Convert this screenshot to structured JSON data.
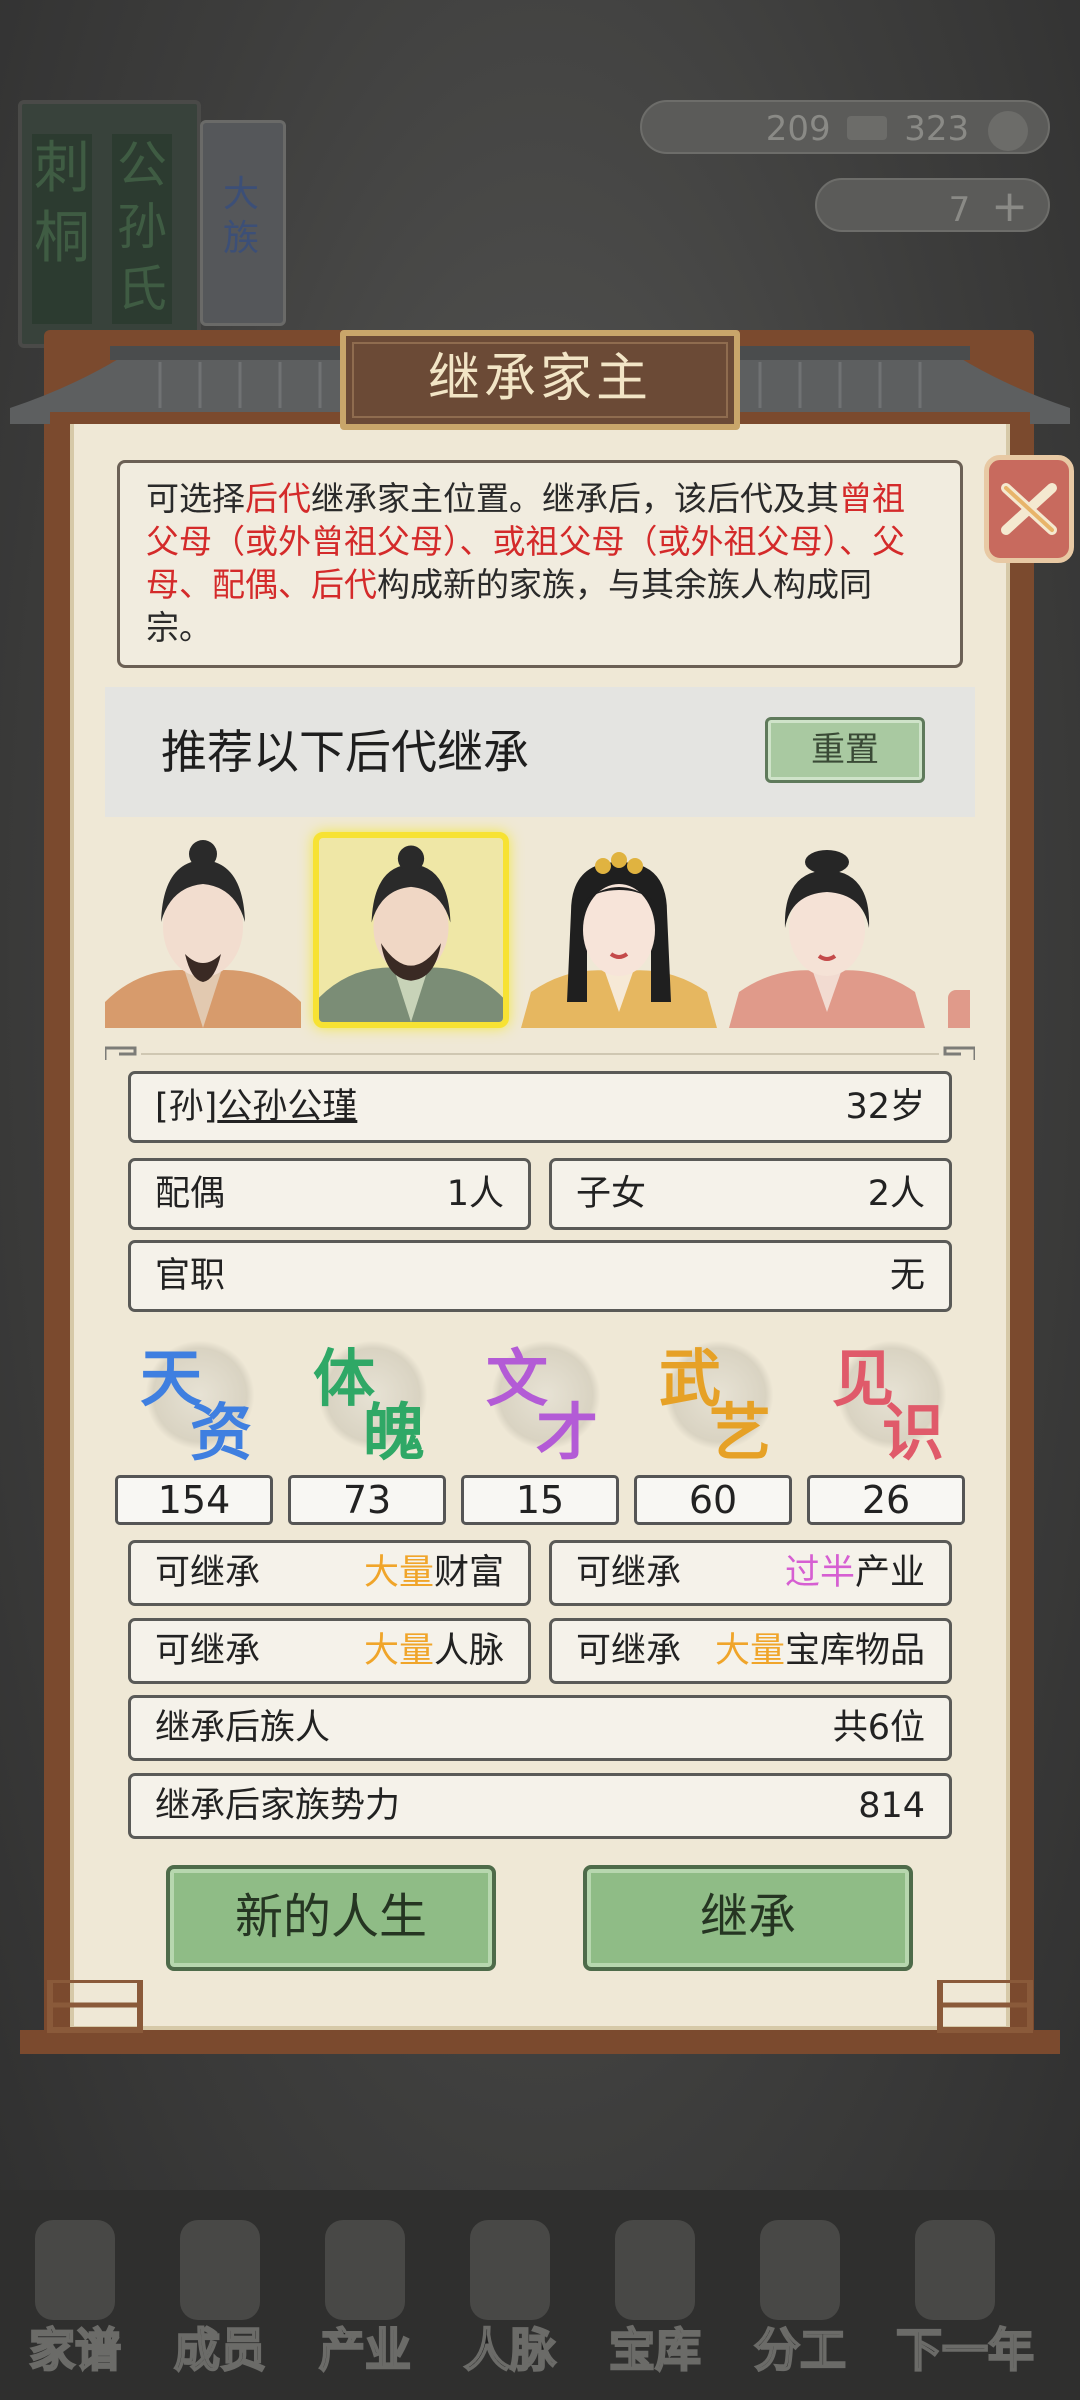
{
  "background": {
    "book1_text": "刺桐",
    "book1_text2": "公孙氏",
    "book2_text": "大族",
    "counter1": {
      "a": "209",
      "b": "323"
    },
    "counter2": {
      "value": "7"
    }
  },
  "dialog": {
    "title": "继承家主",
    "description": {
      "p1": "可选择",
      "p2": "后代",
      "p3": "继承家主位置。继承后，该后代及其",
      "p4": "曾祖父母（或外曾祖父母）、或祖父母（或外祖父母）、父母、配偶、后代",
      "p5": "构成新的家族，与其余族人构成同宗。"
    },
    "recommend_label": "推荐以下后代继承",
    "reset_label": "重置",
    "info": {
      "relation": "[孙]",
      "name": "公孙公瑾",
      "age": "32岁",
      "spouse_label": "配偶",
      "spouse_value": "1人",
      "children_label": "子女",
      "children_value": "2人",
      "office_label": "官职",
      "office_value": "无"
    },
    "attributes": [
      {
        "c1": "天",
        "c2": "资",
        "value": "154",
        "color": "#3f7fe0"
      },
      {
        "c1": "体",
        "c2": "魄",
        "value": "73",
        "color": "#2fa866"
      },
      {
        "c1": "文",
        "c2": "才",
        "value": "15",
        "color": "#b35bd6"
      },
      {
        "c1": "武",
        "c2": "艺",
        "value": "60",
        "color": "#e6a126"
      },
      {
        "c1": "见",
        "c2": "识",
        "value": "26",
        "color": "#e05a6a"
      }
    ],
    "inherit": {
      "wealth": {
        "label": "可继承",
        "amount": "大量",
        "item": "财富"
      },
      "industry": {
        "label": "可继承",
        "amount": "过半",
        "item": "产业"
      },
      "network": {
        "label": "可继承",
        "amount": "大量",
        "item": "人脉"
      },
      "treasury": {
        "label": "可继承",
        "amount": "大量",
        "item": "宝库物品"
      },
      "members_label": "继承后族人",
      "members_value": "共6位",
      "power_label": "继承后家族势力",
      "power_value": "814"
    },
    "new_life_label": "新的人生",
    "inherit_label": "继承"
  },
  "bottom_nav": [
    "家谱",
    "成员",
    "产业",
    "人脉",
    "宝库",
    "分工",
    "下一年"
  ]
}
